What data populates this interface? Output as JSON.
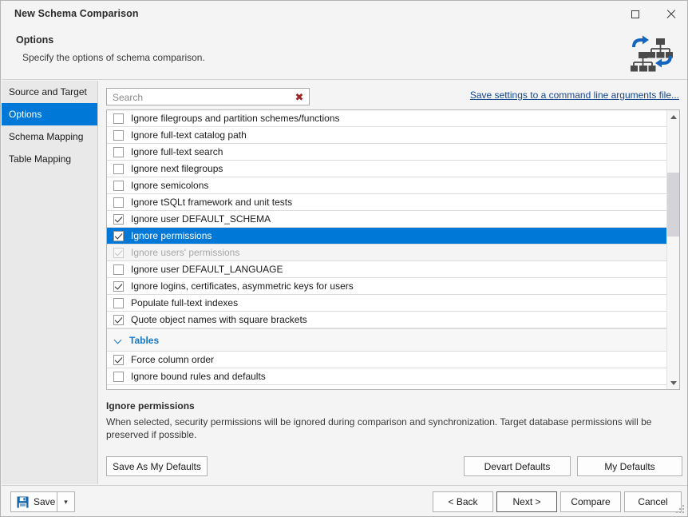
{
  "window": {
    "title": "New Schema Comparison",
    "maximize_label": "Maximize",
    "close_label": "Close"
  },
  "header": {
    "title": "Options",
    "subtitle": "Specify the options of schema comparison.",
    "icon": "schema-comparison-icon"
  },
  "sidebar": {
    "items": [
      {
        "label": "Source and Target",
        "selected": false
      },
      {
        "label": "Options",
        "selected": true
      },
      {
        "label": "Schema Mapping",
        "selected": false
      },
      {
        "label": "Table Mapping",
        "selected": false
      }
    ]
  },
  "search": {
    "value": "",
    "placeholder": "Search",
    "clear_glyph": "✖"
  },
  "command_link": {
    "label": "Save settings to a command line arguments file...",
    "color": "#16478d"
  },
  "options_list": {
    "rows": [
      {
        "type": "option",
        "label": "Ignore filegroups and partition schemes/functions",
        "checked": false,
        "selected": false,
        "disabled": false
      },
      {
        "type": "option",
        "label": "Ignore full-text catalog path",
        "checked": false,
        "selected": false,
        "disabled": false
      },
      {
        "type": "option",
        "label": "Ignore full-text search",
        "checked": false,
        "selected": false,
        "disabled": false
      },
      {
        "type": "option",
        "label": "Ignore next filegroups",
        "checked": false,
        "selected": false,
        "disabled": false
      },
      {
        "type": "option",
        "label": "Ignore semicolons",
        "checked": false,
        "selected": false,
        "disabled": false
      },
      {
        "type": "option",
        "label": "Ignore tSQLt framework and unit tests",
        "checked": false,
        "selected": false,
        "disabled": false
      },
      {
        "type": "option",
        "label": "Ignore user DEFAULT_SCHEMA",
        "checked": true,
        "selected": false,
        "disabled": false
      },
      {
        "type": "option",
        "label": "Ignore permissions",
        "checked": true,
        "selected": true,
        "disabled": false
      },
      {
        "type": "option",
        "label": "Ignore users' permissions",
        "checked": true,
        "selected": false,
        "disabled": true
      },
      {
        "type": "option",
        "label": "Ignore user DEFAULT_LANGUAGE",
        "checked": false,
        "selected": false,
        "disabled": false
      },
      {
        "type": "option",
        "label": "Ignore logins, certificates, asymmetric keys for users",
        "checked": true,
        "selected": false,
        "disabled": false
      },
      {
        "type": "option",
        "label": "Populate full-text indexes",
        "checked": false,
        "selected": false,
        "disabled": false
      },
      {
        "type": "option",
        "label": "Quote object names with square brackets",
        "checked": true,
        "selected": false,
        "disabled": false
      },
      {
        "type": "group",
        "label": "Tables",
        "expanded": true
      },
      {
        "type": "option",
        "label": "Force column order",
        "checked": true,
        "selected": false,
        "disabled": false
      },
      {
        "type": "option",
        "label": "Ignore bound rules and defaults",
        "checked": false,
        "selected": false,
        "disabled": false
      }
    ],
    "selection_color": "#0078d7",
    "group_color": "#1477c8"
  },
  "scrollbar": {
    "up_label": "Scroll up",
    "down_label": "Scroll down",
    "thumb_label": "Scroll thumb"
  },
  "description": {
    "title": "Ignore permissions",
    "body": "When selected, security permissions will be ignored during comparison and synchronization. Target database permissions will be preserved if possible."
  },
  "panel_buttons": {
    "save_as_my_defaults": "Save As My Defaults",
    "devart_defaults": "Devart Defaults",
    "my_defaults": "My Defaults"
  },
  "footer": {
    "save": "Save",
    "save_icon": "floppy-disk-icon",
    "save_dropdown_glyph": "▾",
    "back": "< Back",
    "next": "Next >",
    "compare": "Compare",
    "cancel": "Cancel"
  }
}
